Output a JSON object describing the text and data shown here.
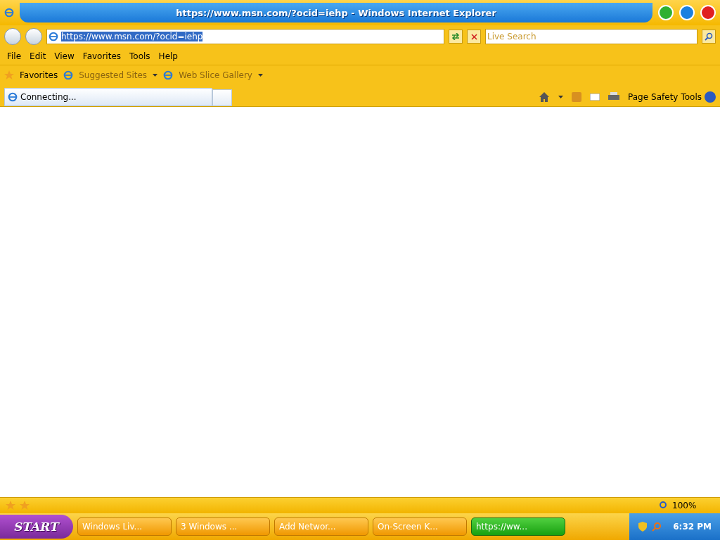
{
  "window": {
    "title": "https://www.msn.com/?ocid=iehp - Windows Internet Explorer"
  },
  "address": {
    "value": "https://www.msn.com/?ocid=iehp",
    "selected": true
  },
  "search": {
    "placeholder": "Live Search"
  },
  "menu": [
    "File",
    "Edit",
    "View",
    "Favorites",
    "Tools",
    "Help"
  ],
  "favorites_bar": {
    "label": "Favorites",
    "items": [
      {
        "label": "Suggested Sites",
        "disabled": true
      },
      {
        "label": "Web Slice Gallery",
        "disabled": true
      }
    ]
  },
  "tabs": [
    {
      "label": "Connecting...",
      "selected": true
    }
  ],
  "command_bar": [
    "Page",
    "Safety",
    "Tools"
  ],
  "status_bar": {
    "zoom": "100%"
  },
  "taskbar": {
    "start": "START",
    "buttons": [
      {
        "label": "Windows Liv...",
        "selected": false
      },
      {
        "label": "3 Windows ...",
        "selected": false
      },
      {
        "label": "Add Networ...",
        "selected": false
      },
      {
        "label": "On-Screen K...",
        "selected": false
      },
      {
        "label": "https://ww...",
        "selected": true
      }
    ],
    "clock": "6:32 PM"
  }
}
